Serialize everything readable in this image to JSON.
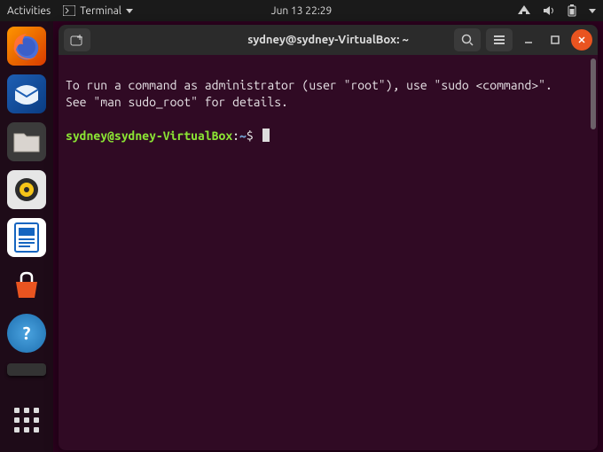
{
  "topbar": {
    "activities": "Activities",
    "app_indicator": "Terminal",
    "clock": "Jun 13  22:29"
  },
  "dock": {
    "firefox": "firefox-icon",
    "thunderbird": "thunderbird-icon",
    "files": "files-icon",
    "rhythmbox": "rhythmbox-icon",
    "writer": "libreoffice-writer-icon",
    "software": "ubuntu-software-icon",
    "help": "help-icon"
  },
  "window": {
    "title": "sydney@sydney-VirtualBox: ~"
  },
  "terminal": {
    "line1": "To run a command as administrator (user \"root\"), use \"sudo <command>\".",
    "line2": "See \"man sudo_root\" for details.",
    "prompt_user": "sydney@sydney-VirtualBox",
    "prompt_sep": ":",
    "prompt_path": "~",
    "prompt_symbol": "$"
  }
}
